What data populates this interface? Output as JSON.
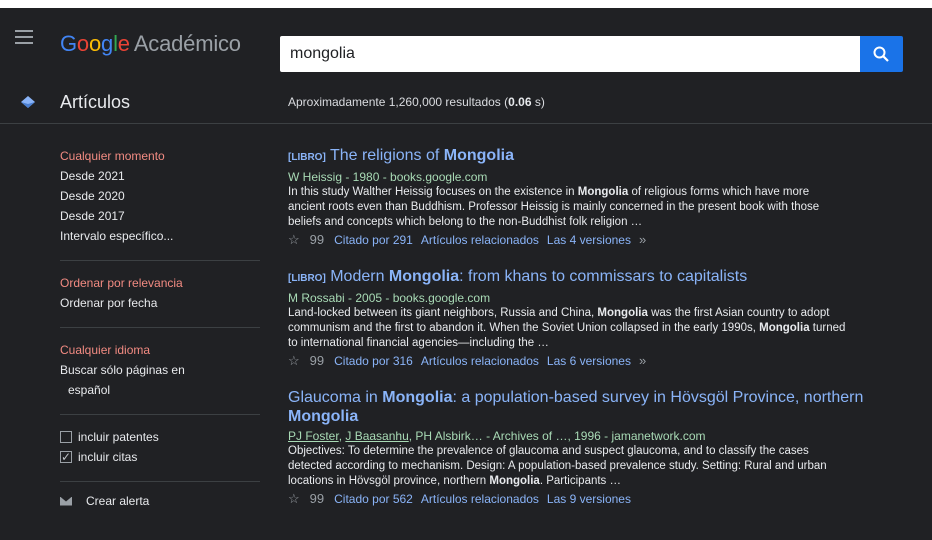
{
  "header": {
    "logo_letters": [
      "G",
      "o",
      "o",
      "g",
      "l",
      "e"
    ],
    "product": "Académico",
    "search_value": "mongolia"
  },
  "subbar": {
    "section": "Artículos",
    "count_prefix": "Aproximadamente 1,260,000 resultados (",
    "count_time": "0.06",
    "count_suffix": " s)"
  },
  "sidebar": {
    "time": [
      "Cualquier momento",
      "Desde 2021",
      "Desde 2020",
      "Desde 2017",
      "Intervalo específico..."
    ],
    "sort": [
      "Ordenar por relevancia",
      "Ordenar por fecha"
    ],
    "language": [
      "Cualquier idioma",
      "Buscar sólo páginas en",
      "español"
    ],
    "include_patents": "incluir patentes",
    "include_citations": "incluir citas",
    "create_alert": "Crear alerta"
  },
  "results": [
    {
      "tag": "[LIBRO]",
      "title_pre": " The religions of ",
      "title_bold": "Mongolia",
      "title_post": "",
      "title_bold2": "",
      "meta": "W Heissig - 1980 - books.google.com",
      "snippet_1": "In this study Walther Heissig focuses on the existence in ",
      "snippet_b1": "Mongolia",
      "snippet_2": " of religious forms which have more ancient roots even than Buddhism. Professor Heissig is mainly concerned in the present book with those beliefs and concepts which belong to the non-Buddhist folk religion …",
      "snippet_b2": "",
      "snippet_3": "",
      "cited": "Citado por 291",
      "related": "Artículos relacionados",
      "versions": "Las 4 versiones",
      "more": "»"
    },
    {
      "tag": "[LIBRO]",
      "title_pre": " Modern ",
      "title_bold": "Mongolia",
      "title_post": ": from khans to commissars to capitalists",
      "title_bold2": "",
      "meta": "M Rossabi - 2005 - books.google.com",
      "snippet_1": "Land-locked between its giant neighbors, Russia and China, ",
      "snippet_b1": "Mongolia",
      "snippet_2": " was the first Asian country to adopt communism and the first to abandon it. When the Soviet Union collapsed in the early 1990s, ",
      "snippet_b2": "Mongolia",
      "snippet_3": " turned to international financial agencies—including the …",
      "cited": "Citado por 316",
      "related": "Artículos relacionados",
      "versions": "Las 6 versiones",
      "more": "»"
    },
    {
      "tag": "",
      "title_pre": "Glaucoma in ",
      "title_bold": "Mongolia",
      "title_post": ": a population-based survey in Hövsgöl Province, northern ",
      "title_bold2": "Mongolia",
      "meta_authors": [
        "PJ Foster",
        "J Baasanhu"
      ],
      "meta_rest": ", PH Alsbirk… - Archives of …, 1996 - jamanetwork.com",
      "snippet_1": "Objectives: To determine the prevalence of glaucoma and suspect glaucoma, and to classify the cases detected according to mechanism. Design: A population-based prevalence study. Setting: Rural and urban locations in Hövsgöl province, northern ",
      "snippet_b1": "Mongolia",
      "snippet_2": ". Participants …",
      "cited": "Citado por 562",
      "related": "Artículos relacionados",
      "versions": "Las 9 versiones"
    }
  ],
  "icons": {
    "menu": "hamburger-menu-icon",
    "search": "search-icon",
    "section": "diamond-icon",
    "star": "☆",
    "cite": "99",
    "more": "chevron-double-right-icon",
    "alert": "mail-icon"
  },
  "colors": {
    "accent_blue": "#1a73e8",
    "link": "#8ab4f8",
    "active_red": "#f28b82",
    "meta_green": "#a8dab5"
  }
}
